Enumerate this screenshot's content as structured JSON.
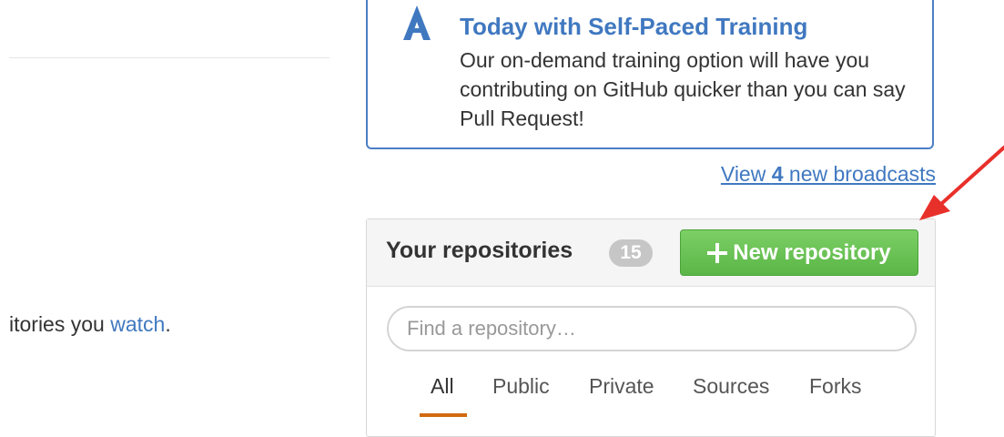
{
  "left": {
    "watch_prefix": "itories you ",
    "watch_link": "watch",
    "watch_suffix": "."
  },
  "broadcast": {
    "title": "Today with Self-Paced Training",
    "body": "Our on-demand training option will have you contributing on GitHub quicker than you can say Pull Request!",
    "view_prefix": "View ",
    "view_count": "4",
    "view_suffix": " new broadcasts",
    "icon": "octocat-training-icon"
  },
  "repositories": {
    "title": "Your repositories",
    "count": "15",
    "new_button_label": "New repository",
    "search_placeholder": "Find a repository…",
    "filters": [
      {
        "label": "All",
        "selected": true
      },
      {
        "label": "Public",
        "selected": false
      },
      {
        "label": "Private",
        "selected": false
      },
      {
        "label": "Sources",
        "selected": false
      },
      {
        "label": "Forks",
        "selected": false
      }
    ]
  },
  "colors": {
    "link": "#4078c0",
    "button_green": "#5bb647",
    "tab_underline": "#d26911",
    "arrow_red": "#e8302a"
  }
}
